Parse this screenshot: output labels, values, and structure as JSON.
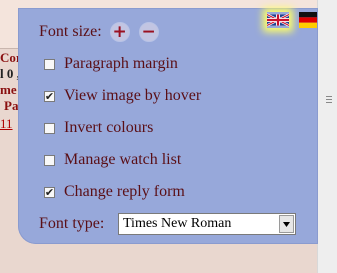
{
  "background": {
    "lines": [
      "Cor",
      "l 0 ,",
      "me",
      "Pa",
      "11"
    ]
  },
  "font_size": {
    "label": "Font size:",
    "increase": "+",
    "decrease": "−"
  },
  "languages": [
    {
      "name": "uk-flag-icon"
    },
    {
      "name": "german-flag-icon"
    }
  ],
  "options": [
    {
      "label": "Paragraph margin",
      "checked": false
    },
    {
      "label": "View image by hover",
      "checked": true
    },
    {
      "label": "Invert colours",
      "checked": false
    },
    {
      "label": "Manage watch list",
      "checked": false
    },
    {
      "label": "Change reply form",
      "checked": true
    }
  ],
  "font_type": {
    "label": "Font type:",
    "value": "Times New Roman"
  },
  "colors": {
    "panel": "#97a8da",
    "text": "#5a0f16",
    "page": "#e9d7cf"
  }
}
